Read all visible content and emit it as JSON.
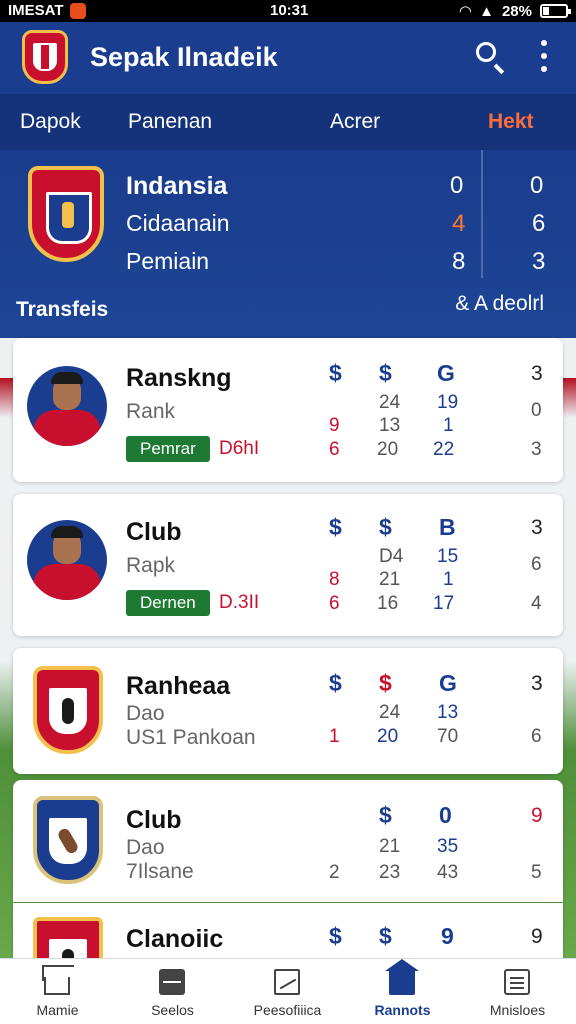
{
  "status_bar": {
    "carrier": "IMESAT",
    "time": "10:31",
    "battery": "28%"
  },
  "header": {
    "title": "Sepak Ilnadeik"
  },
  "tabs": [
    {
      "label": "Dapok"
    },
    {
      "label": "Panenan"
    },
    {
      "label": "Acrer"
    },
    {
      "label": "Hekt",
      "active": true
    }
  ],
  "hero": {
    "team_name": "Indansia",
    "rows": [
      {
        "label": "Cidaanain",
        "a": "4",
        "b": "6"
      },
      {
        "label": "Pemiain",
        "a": "8",
        "b": "3"
      }
    ],
    "top": {
      "a": "0",
      "b": "0"
    },
    "section_title": "Transfeis",
    "section_right": "& A deolrl"
  },
  "cards": [
    {
      "title": "Ranskng",
      "subtitle": "Rank",
      "pill": "Pemrar",
      "pill_value": "D6hI",
      "symbols": [
        "$",
        "$",
        "G"
      ],
      "head_right": "3",
      "rows": [
        [
          "",
          "24",
          "19",
          "0"
        ],
        [
          "9",
          "13",
          "1",
          ""
        ],
        [
          "6",
          "20",
          "22",
          "3"
        ]
      ]
    },
    {
      "title": "Club",
      "subtitle": "Rapk",
      "pill": "Dernen",
      "pill_value": "D.3II",
      "symbols": [
        "$",
        "$",
        "B"
      ],
      "head_right": "3",
      "rows": [
        [
          "",
          "D4",
          "15",
          "6"
        ],
        [
          "8",
          "21",
          "1",
          ""
        ],
        [
          "6",
          "16",
          "17",
          "4"
        ]
      ]
    },
    {
      "title": "Ranheaa",
      "subtitle": "Dao",
      "line3": "US1 Pankoan",
      "symbols": [
        "$",
        "$",
        "G"
      ],
      "head_right": "3",
      "rows": [
        [
          "",
          "24",
          "13",
          ""
        ],
        [
          "1",
          "20",
          "70",
          "6"
        ]
      ]
    },
    {
      "title": "Club",
      "subtitle": "Dao",
      "line3": "7Ilsane",
      "symbols": [
        "",
        "$",
        "0"
      ],
      "head_right": "9",
      "rows": [
        [
          "",
          "21",
          "35",
          ""
        ],
        [
          "2",
          "23",
          "43",
          "5"
        ]
      ]
    },
    {
      "title": "Clanoiic",
      "symbols": [
        "$",
        "$",
        "9"
      ],
      "head_right": "9"
    }
  ],
  "bottom_nav": [
    {
      "label": "Mamie"
    },
    {
      "label": "Seelos"
    },
    {
      "label": "Peesofiiica"
    },
    {
      "label": "Rannots",
      "active": true
    },
    {
      "label": "Mnisloes"
    }
  ],
  "colors": {
    "primary": "#1b3d8f",
    "accent": "#ff6b3a",
    "red": "#c8102e",
    "green": "#1e7a32"
  }
}
